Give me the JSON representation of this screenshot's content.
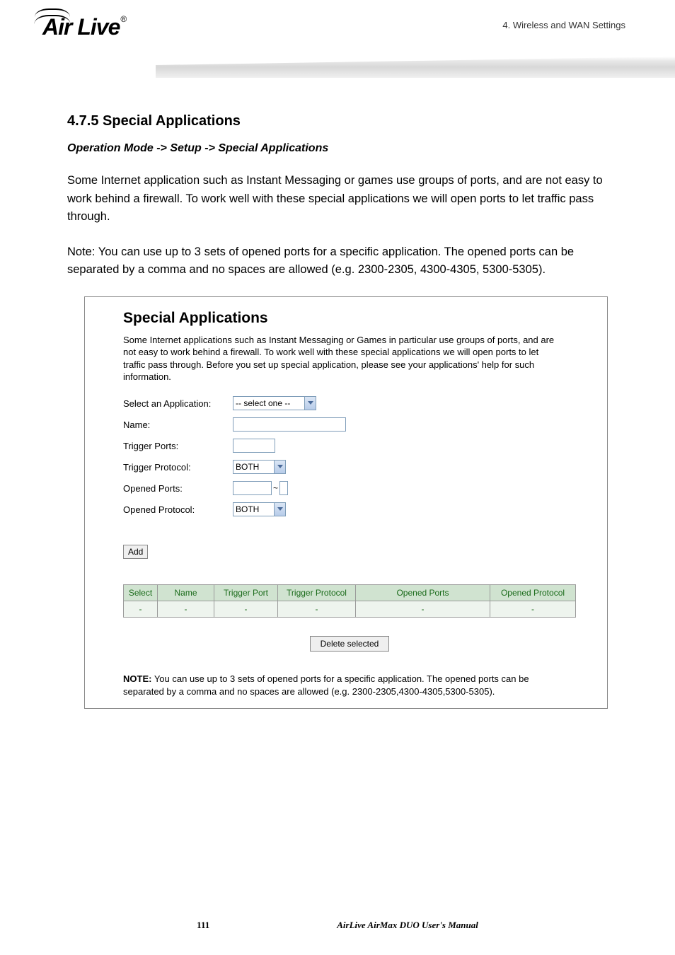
{
  "header": {
    "logo_text": "Air Live",
    "breadcrumb": "4.  Wireless  and  WAN  Settings"
  },
  "section": {
    "title": "4.7.5 Special Applications",
    "path": "Operation Mode -> Setup -> Special Applications",
    "para1": "Some Internet application such as Instant Messaging or games use groups of ports, and are not easy to work behind a firewall. To work well with these special applications we will open ports to let traffic pass through.",
    "para2": "Note: You can use up to 3 sets of opened ports for a specific application. The opened ports can be separated by a comma and no spaces are allowed (e.g. 2300-2305, 4300-4305, 5300-5305)."
  },
  "screenshot": {
    "title": "Special Applications",
    "desc": "Some Internet applications such as Instant Messaging or Games in particular use groups of ports, and are not easy to work behind a firewall. To work well with these special applications we will open ports to let traffic pass through. Before you set up special application, please see your applications' help for such information.",
    "labels": {
      "select_app": "Select an Application:",
      "name": "Name:",
      "trigger_ports": "Trigger Ports:",
      "trigger_protocol": "Trigger Protocol:",
      "opened_ports": "Opened Ports:",
      "opened_protocol": "Opened Protocol:"
    },
    "values": {
      "select_app_selected": "-- select one --",
      "name_value": "",
      "trigger_ports_value": "",
      "trigger_protocol_selected": "BOTH",
      "opened_ports_a": "",
      "opened_ports_b": "",
      "opened_protocol_selected": "BOTH"
    },
    "buttons": {
      "add": "Add",
      "delete": "Delete selected"
    },
    "table": {
      "cols": [
        "Select",
        "Name",
        "Trigger Port",
        "Trigger Protocol",
        "Opened Ports",
        "Opened Protocol"
      ],
      "row": [
        "-",
        "-",
        "-",
        "-",
        "-",
        "-"
      ]
    },
    "note_label": "NOTE:",
    "note_text": " You can use up to 3 sets of opened ports for a specific application. The opened ports can be separated by a comma and no spaces are allowed (e.g. 2300-2305,4300-4305,5300-5305)."
  },
  "footer": {
    "page": "111",
    "manual": "AirLive  AirMax  DUO  User's  Manual"
  }
}
